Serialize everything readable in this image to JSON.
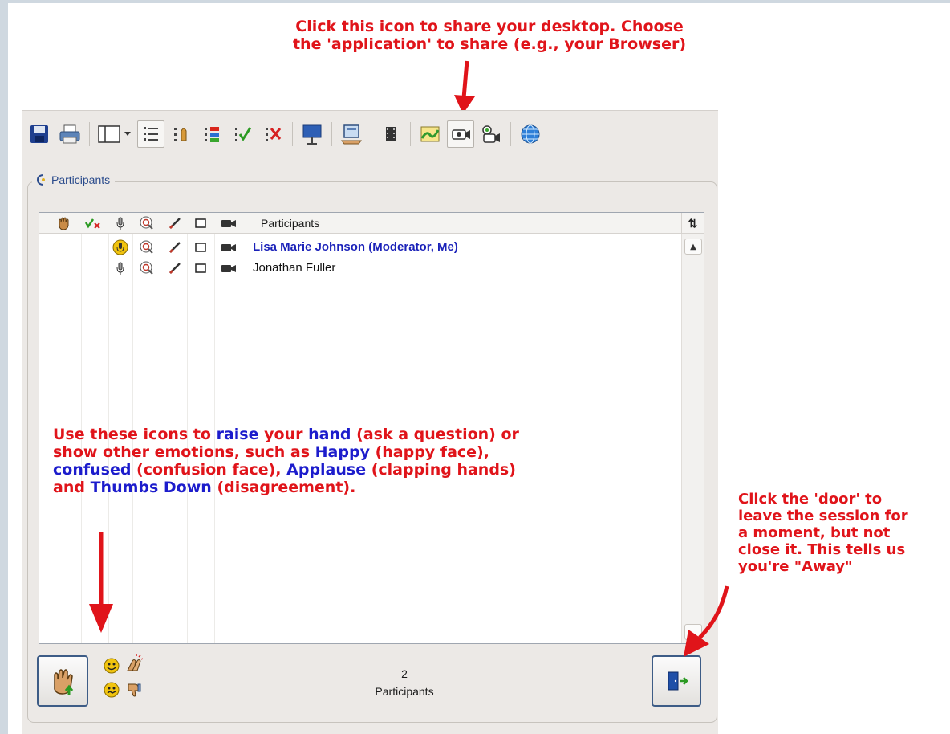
{
  "annotations": {
    "top": [
      "Click this icon to share your desktop. Choose",
      "the 'application' to share (e.g., your Browser)"
    ],
    "middle": {
      "l1a": "Use these icons to ",
      "l1b": "raise",
      "l1c": " your ",
      "l1d": "hand",
      "l1e": " (ask a question) or",
      "l2a": "show other emotions, such as ",
      "l2b": "Happy",
      "l2c": " (happy face),",
      "l3a": "confused",
      "l3b": " (confusion face), ",
      "l3c": "Applause",
      "l3d": " (clapping hands)",
      "l4a": "and ",
      "l4b": "Thumbs Down",
      "l4c": " (disagreement)."
    },
    "right": [
      "Click the 'door' to",
      "leave the session for",
      "a moment, but not",
      "close it. This tells us",
      "you're \"Away\""
    ]
  },
  "toolbar": {
    "icons": [
      "save-icon",
      "print-icon",
      "layout-icon",
      "list-view-icon",
      "raise-hand-list-icon",
      "status-list-icon",
      "check-icon",
      "clear-status-icon",
      "whiteboard-icon",
      "share-desktop-icon",
      "film-icon",
      "map-icon",
      "camera-icon",
      "cameras-icon",
      "web-icon"
    ]
  },
  "panel": {
    "title": "Participants",
    "header_label": "Participants",
    "sort_label": "⇅",
    "participants": [
      {
        "name": "Lisa Marie Johnson (Moderator, Me)",
        "is_me": true
      },
      {
        "name": "Jonathan Fuller",
        "is_me": false
      }
    ],
    "count": "2",
    "count_label": "Participants"
  },
  "colors": {
    "annotation_red": "#e0141a",
    "annotation_blue": "#1c1ccc",
    "me_name": "#1b22b9",
    "panel_bg": "#ece9e6"
  }
}
